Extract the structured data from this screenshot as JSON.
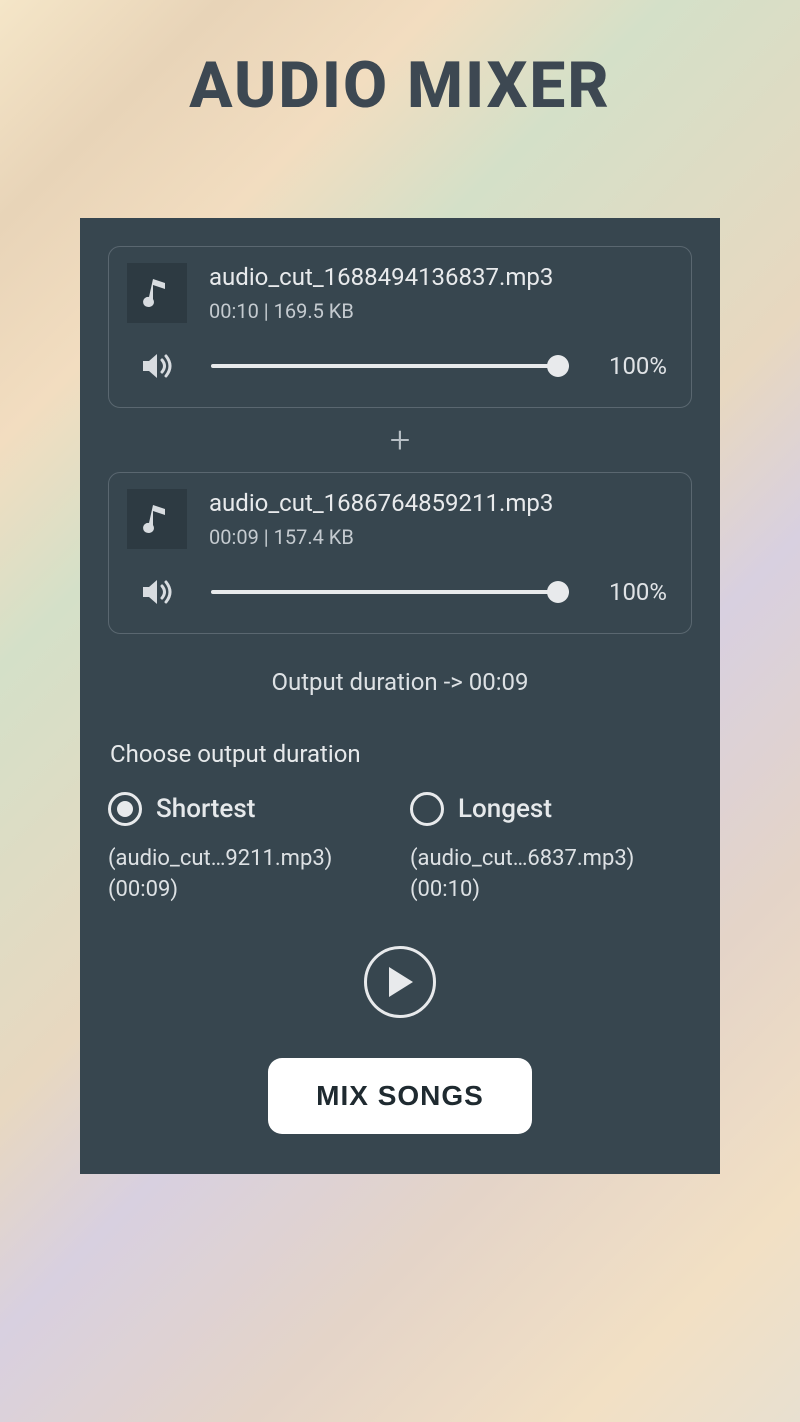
{
  "header": {
    "title": "AUDIO MIXER"
  },
  "tracks": [
    {
      "filename": "audio_cut_1688494136837.mp3",
      "meta": "00:10 | 169.5 KB",
      "volume": "100%"
    },
    {
      "filename": "audio_cut_1686764859211.mp3",
      "meta": "00:09 | 157.4 KB",
      "volume": "100%"
    }
  ],
  "add_symbol": "+",
  "output_duration_label": "Output duration -> 00:09",
  "choose_label": "Choose output duration",
  "radio_options": {
    "shortest": {
      "label": "Shortest",
      "sub_line1": "(audio_cut…9211.mp3)",
      "sub_line2": "(00:09)"
    },
    "longest": {
      "label": "Longest",
      "sub_line1": "(audio_cut…6837.mp3)",
      "sub_line2": "(00:10)"
    }
  },
  "mix_button_label": "MIX SONGS"
}
